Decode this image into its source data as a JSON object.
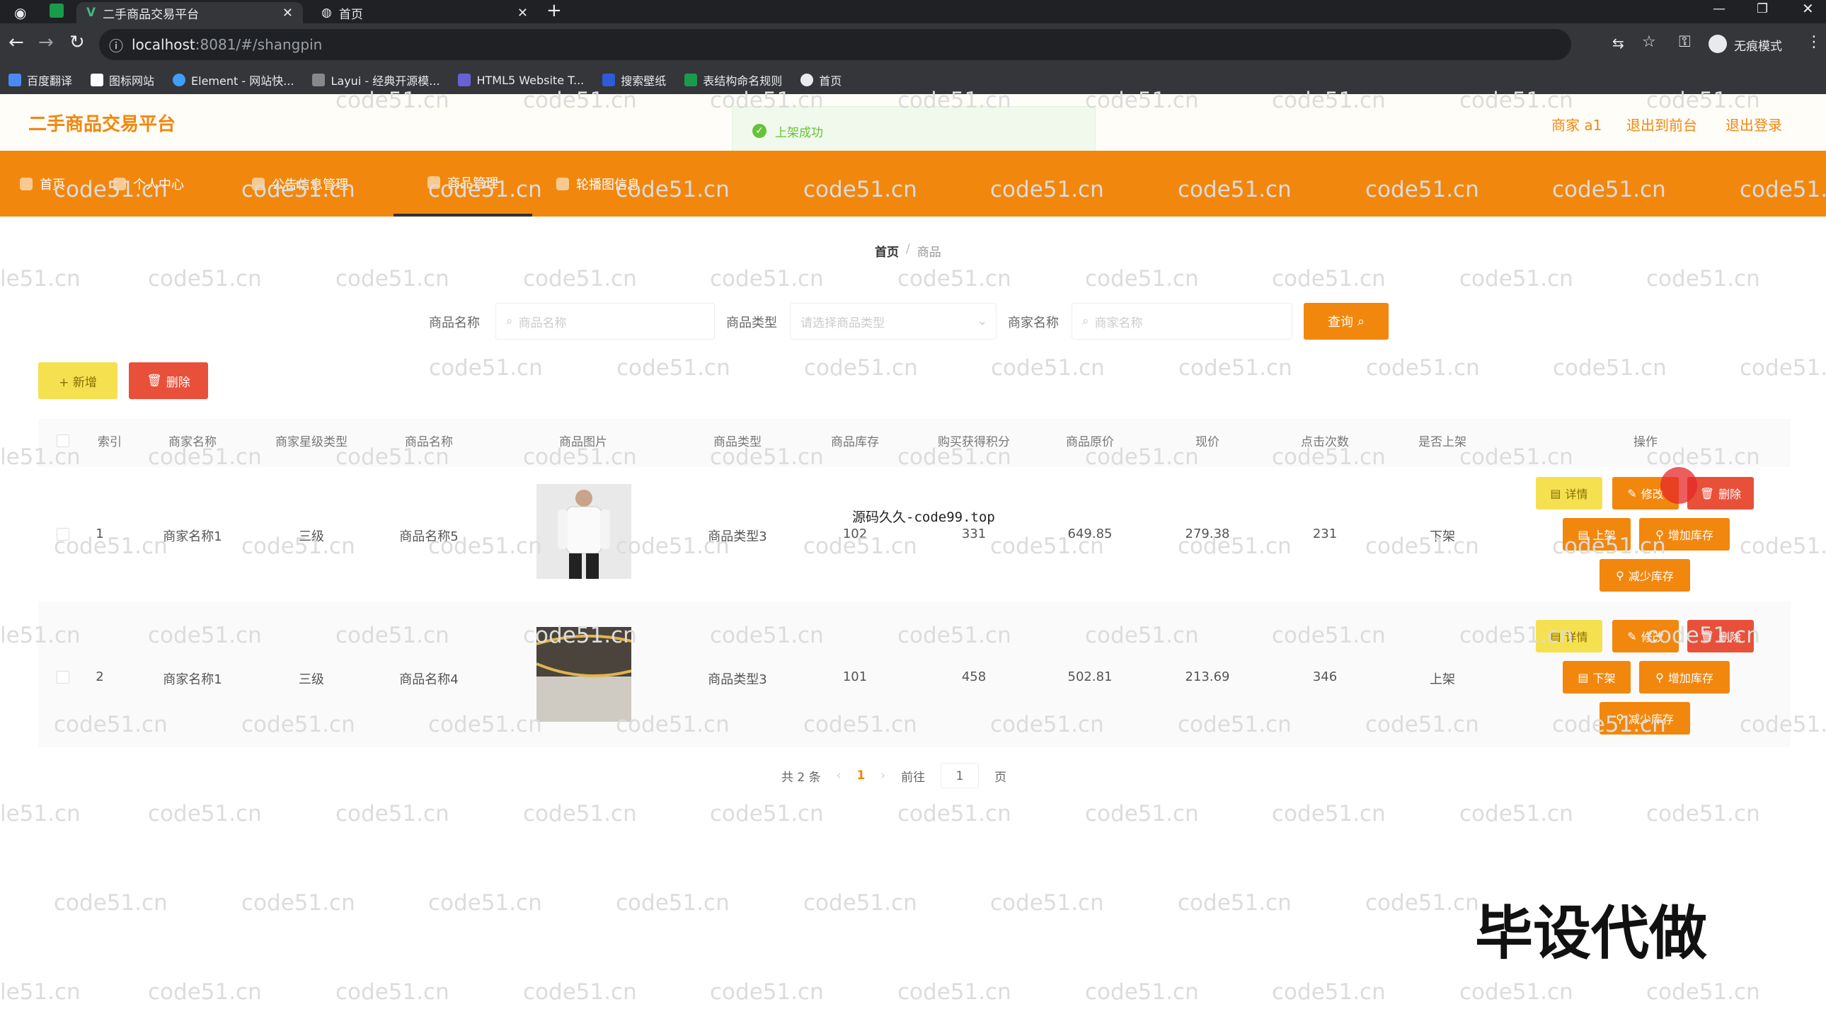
{
  "browser": {
    "tabs": [
      {
        "label": "二手商品交易平台"
      },
      {
        "label": "首页"
      }
    ],
    "new_tab": "+",
    "url_host": "localhost",
    "url_rest": ":8081/#/shangpin",
    "incognito_label": "无痕模式",
    "bookmarks": [
      "百度翻译",
      "图标网站",
      "Element - 网站快...",
      "Layui - 经典开源模...",
      "HTML5 Website T...",
      "搜索壁纸",
      "表结构命名规则",
      "首页"
    ]
  },
  "app": {
    "logo": "二手商品交易平台",
    "toast": "上架成功",
    "user": "商家 a1",
    "to_front": "退出到前台",
    "logout": "退出登录",
    "menu": [
      "首页",
      "个人中心",
      "公告信息管理",
      "商品管理",
      "轮播图信息"
    ],
    "breadcrumb": {
      "home": "首页",
      "sep": "/",
      "current": "商品"
    }
  },
  "search": {
    "name_label": "商品名称",
    "name_placeholder": "商品名称",
    "type_label": "商品类型",
    "type_placeholder": "请选择商品类型",
    "merchant_label": "商家名称",
    "merchant_placeholder": "商家名称",
    "query_button": "查询"
  },
  "actions": {
    "add": "+ 新增",
    "delete": "删除"
  },
  "table": {
    "headers": [
      "索引",
      "商家名称",
      "商家星级类型",
      "商品名称",
      "商品图片",
      "商品类型",
      "商品库存",
      "购买获得积分",
      "商品原价",
      "现价",
      "点击次数",
      "是否上架",
      "操作"
    ],
    "rows": [
      {
        "index": "1",
        "merchant": "商家名称1",
        "level": "三级",
        "name": "商品名称5",
        "type": "商品类型3",
        "stock": "102",
        "points": "331",
        "orig_price": "649.85",
        "price": "279.38",
        "clicks": "231",
        "listed": "下架",
        "toggle": "上架"
      },
      {
        "index": "2",
        "merchant": "商家名称1",
        "level": "三级",
        "name": "商品名称4",
        "type": "商品类型3",
        "stock": "101",
        "points": "458",
        "orig_price": "502.81",
        "price": "213.69",
        "clicks": "346",
        "listed": "上架",
        "toggle": "下架"
      }
    ],
    "op_labels": {
      "detail": "详情",
      "edit": "修改",
      "delete": "删除",
      "add_stock": "增加库存",
      "reduce_stock": "减少库存"
    }
  },
  "pagination": {
    "total": "共 2 条",
    "page": "1",
    "goto": "前往",
    "goto_value": "1",
    "page_suffix": "页"
  },
  "overlay": {
    "source_text": "源码久久-code99.top",
    "promo": "毕设代做",
    "watermark": "code51.cn",
    "watermark_edge": "le51.cn"
  }
}
